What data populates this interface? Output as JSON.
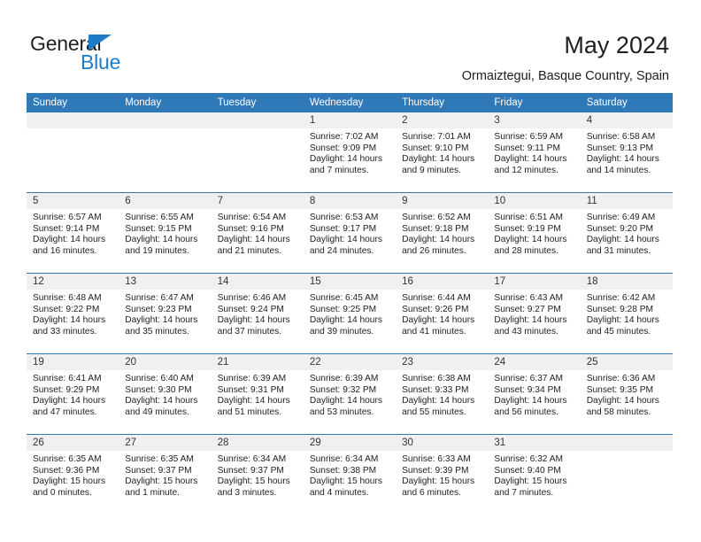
{
  "logo": {
    "word1": "General",
    "word2": "Blue",
    "triangle_color": "#1e7bc4"
  },
  "header": {
    "title": "May 2024",
    "subtitle": "Ormaiztegui, Basque Country, Spain"
  },
  "theme": {
    "header_blue": "#3079b8",
    "daynum_bg": "#f0f0f0",
    "text": "#222222"
  },
  "calendar": {
    "weekday_headers": [
      "Sunday",
      "Monday",
      "Tuesday",
      "Wednesday",
      "Thursday",
      "Friday",
      "Saturday"
    ],
    "weeks": [
      [
        {
          "day": "",
          "blank": true,
          "sunrise": "",
          "sunset": "",
          "daylight1": "",
          "daylight2": ""
        },
        {
          "day": "",
          "blank": true,
          "sunrise": "",
          "sunset": "",
          "daylight1": "",
          "daylight2": ""
        },
        {
          "day": "",
          "blank": true,
          "sunrise": "",
          "sunset": "",
          "daylight1": "",
          "daylight2": ""
        },
        {
          "day": "1",
          "sunrise": "Sunrise: 7:02 AM",
          "sunset": "Sunset: 9:09 PM",
          "daylight1": "Daylight: 14 hours",
          "daylight2": "and 7 minutes."
        },
        {
          "day": "2",
          "sunrise": "Sunrise: 7:01 AM",
          "sunset": "Sunset: 9:10 PM",
          "daylight1": "Daylight: 14 hours",
          "daylight2": "and 9 minutes."
        },
        {
          "day": "3",
          "sunrise": "Sunrise: 6:59 AM",
          "sunset": "Sunset: 9:11 PM",
          "daylight1": "Daylight: 14 hours",
          "daylight2": "and 12 minutes."
        },
        {
          "day": "4",
          "sunrise": "Sunrise: 6:58 AM",
          "sunset": "Sunset: 9:13 PM",
          "daylight1": "Daylight: 14 hours",
          "daylight2": "and 14 minutes."
        }
      ],
      [
        {
          "day": "5",
          "sunrise": "Sunrise: 6:57 AM",
          "sunset": "Sunset: 9:14 PM",
          "daylight1": "Daylight: 14 hours",
          "daylight2": "and 16 minutes."
        },
        {
          "day": "6",
          "sunrise": "Sunrise: 6:55 AM",
          "sunset": "Sunset: 9:15 PM",
          "daylight1": "Daylight: 14 hours",
          "daylight2": "and 19 minutes."
        },
        {
          "day": "7",
          "sunrise": "Sunrise: 6:54 AM",
          "sunset": "Sunset: 9:16 PM",
          "daylight1": "Daylight: 14 hours",
          "daylight2": "and 21 minutes."
        },
        {
          "day": "8",
          "sunrise": "Sunrise: 6:53 AM",
          "sunset": "Sunset: 9:17 PM",
          "daylight1": "Daylight: 14 hours",
          "daylight2": "and 24 minutes."
        },
        {
          "day": "9",
          "sunrise": "Sunrise: 6:52 AM",
          "sunset": "Sunset: 9:18 PM",
          "daylight1": "Daylight: 14 hours",
          "daylight2": "and 26 minutes."
        },
        {
          "day": "10",
          "sunrise": "Sunrise: 6:51 AM",
          "sunset": "Sunset: 9:19 PM",
          "daylight1": "Daylight: 14 hours",
          "daylight2": "and 28 minutes."
        },
        {
          "day": "11",
          "sunrise": "Sunrise: 6:49 AM",
          "sunset": "Sunset: 9:20 PM",
          "daylight1": "Daylight: 14 hours",
          "daylight2": "and 31 minutes."
        }
      ],
      [
        {
          "day": "12",
          "sunrise": "Sunrise: 6:48 AM",
          "sunset": "Sunset: 9:22 PM",
          "daylight1": "Daylight: 14 hours",
          "daylight2": "and 33 minutes."
        },
        {
          "day": "13",
          "sunrise": "Sunrise: 6:47 AM",
          "sunset": "Sunset: 9:23 PM",
          "daylight1": "Daylight: 14 hours",
          "daylight2": "and 35 minutes."
        },
        {
          "day": "14",
          "sunrise": "Sunrise: 6:46 AM",
          "sunset": "Sunset: 9:24 PM",
          "daylight1": "Daylight: 14 hours",
          "daylight2": "and 37 minutes."
        },
        {
          "day": "15",
          "sunrise": "Sunrise: 6:45 AM",
          "sunset": "Sunset: 9:25 PM",
          "daylight1": "Daylight: 14 hours",
          "daylight2": "and 39 minutes."
        },
        {
          "day": "16",
          "sunrise": "Sunrise: 6:44 AM",
          "sunset": "Sunset: 9:26 PM",
          "daylight1": "Daylight: 14 hours",
          "daylight2": "and 41 minutes."
        },
        {
          "day": "17",
          "sunrise": "Sunrise: 6:43 AM",
          "sunset": "Sunset: 9:27 PM",
          "daylight1": "Daylight: 14 hours",
          "daylight2": "and 43 minutes."
        },
        {
          "day": "18",
          "sunrise": "Sunrise: 6:42 AM",
          "sunset": "Sunset: 9:28 PM",
          "daylight1": "Daylight: 14 hours",
          "daylight2": "and 45 minutes."
        }
      ],
      [
        {
          "day": "19",
          "sunrise": "Sunrise: 6:41 AM",
          "sunset": "Sunset: 9:29 PM",
          "daylight1": "Daylight: 14 hours",
          "daylight2": "and 47 minutes."
        },
        {
          "day": "20",
          "sunrise": "Sunrise: 6:40 AM",
          "sunset": "Sunset: 9:30 PM",
          "daylight1": "Daylight: 14 hours",
          "daylight2": "and 49 minutes."
        },
        {
          "day": "21",
          "sunrise": "Sunrise: 6:39 AM",
          "sunset": "Sunset: 9:31 PM",
          "daylight1": "Daylight: 14 hours",
          "daylight2": "and 51 minutes."
        },
        {
          "day": "22",
          "sunrise": "Sunrise: 6:39 AM",
          "sunset": "Sunset: 9:32 PM",
          "daylight1": "Daylight: 14 hours",
          "daylight2": "and 53 minutes."
        },
        {
          "day": "23",
          "sunrise": "Sunrise: 6:38 AM",
          "sunset": "Sunset: 9:33 PM",
          "daylight1": "Daylight: 14 hours",
          "daylight2": "and 55 minutes."
        },
        {
          "day": "24",
          "sunrise": "Sunrise: 6:37 AM",
          "sunset": "Sunset: 9:34 PM",
          "daylight1": "Daylight: 14 hours",
          "daylight2": "and 56 minutes."
        },
        {
          "day": "25",
          "sunrise": "Sunrise: 6:36 AM",
          "sunset": "Sunset: 9:35 PM",
          "daylight1": "Daylight: 14 hours",
          "daylight2": "and 58 minutes."
        }
      ],
      [
        {
          "day": "26",
          "sunrise": "Sunrise: 6:35 AM",
          "sunset": "Sunset: 9:36 PM",
          "daylight1": "Daylight: 15 hours",
          "daylight2": "and 0 minutes."
        },
        {
          "day": "27",
          "sunrise": "Sunrise: 6:35 AM",
          "sunset": "Sunset: 9:37 PM",
          "daylight1": "Daylight: 15 hours",
          "daylight2": "and 1 minute."
        },
        {
          "day": "28",
          "sunrise": "Sunrise: 6:34 AM",
          "sunset": "Sunset: 9:37 PM",
          "daylight1": "Daylight: 15 hours",
          "daylight2": "and 3 minutes."
        },
        {
          "day": "29",
          "sunrise": "Sunrise: 6:34 AM",
          "sunset": "Sunset: 9:38 PM",
          "daylight1": "Daylight: 15 hours",
          "daylight2": "and 4 minutes."
        },
        {
          "day": "30",
          "sunrise": "Sunrise: 6:33 AM",
          "sunset": "Sunset: 9:39 PM",
          "daylight1": "Daylight: 15 hours",
          "daylight2": "and 6 minutes."
        },
        {
          "day": "31",
          "sunrise": "Sunrise: 6:32 AM",
          "sunset": "Sunset: 9:40 PM",
          "daylight1": "Daylight: 15 hours",
          "daylight2": "and 7 minutes."
        },
        {
          "day": "",
          "blank": true,
          "sunrise": "",
          "sunset": "",
          "daylight1": "",
          "daylight2": ""
        }
      ]
    ]
  }
}
